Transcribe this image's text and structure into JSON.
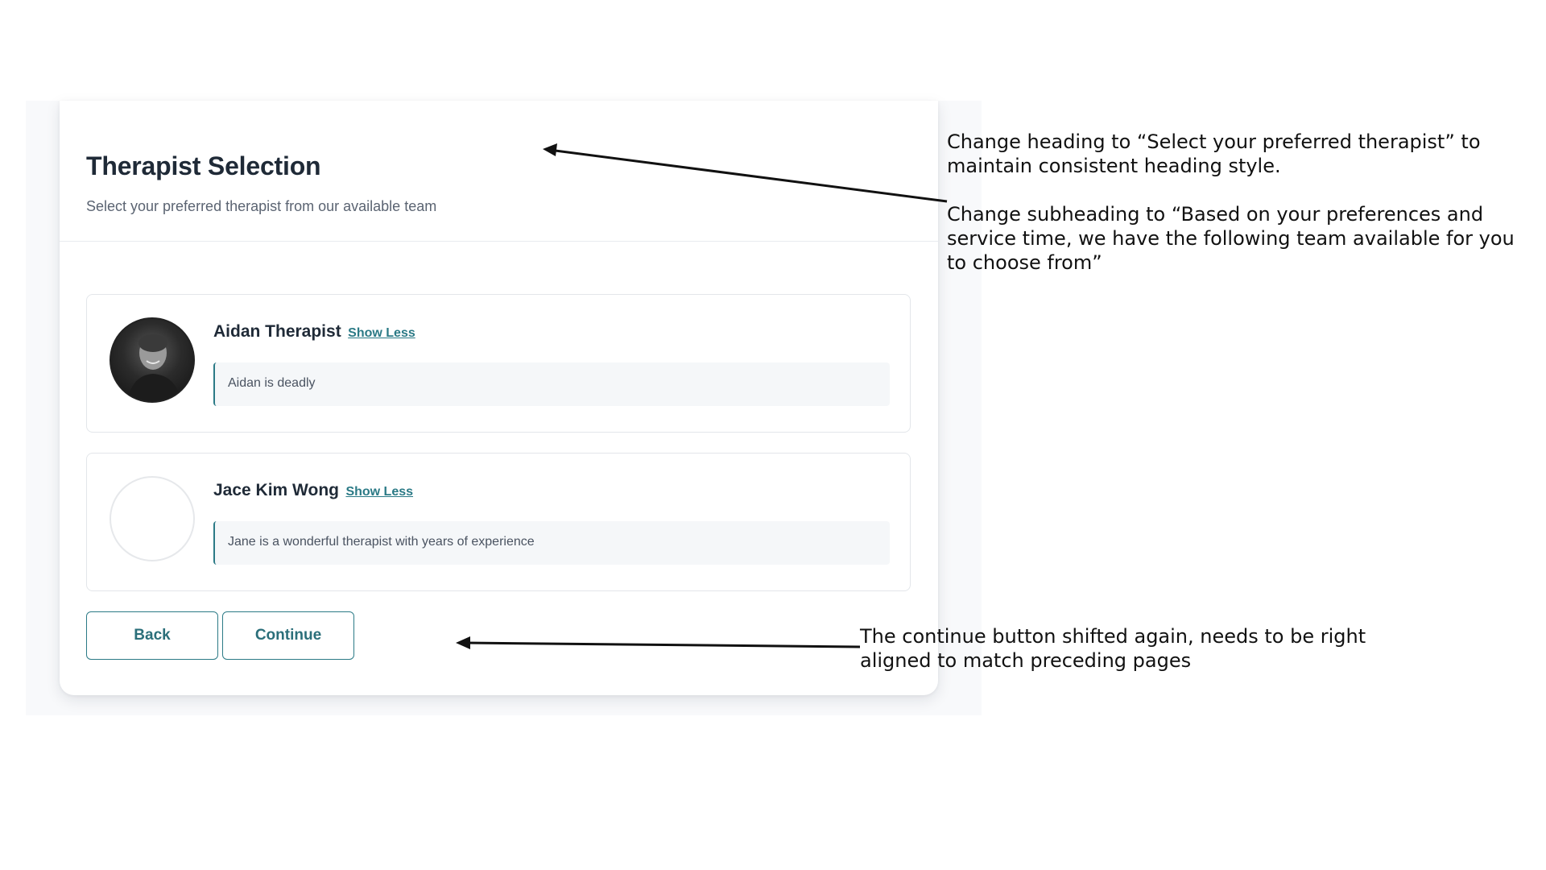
{
  "page": {
    "title": "Therapist Selection",
    "subtitle": "Select your preferred therapist from our available team"
  },
  "therapists": [
    {
      "name": "Aidan Therapist",
      "toggle_label": "Show Less",
      "bio": "Aidan is deadly",
      "has_photo": true
    },
    {
      "name": "Jace Kim Wong",
      "toggle_label": "Show Less",
      "bio": "Jane is a wonderful therapist with years of experience",
      "has_photo": false
    }
  ],
  "actions": {
    "back_label": "Back",
    "continue_label": "Continue"
  },
  "annotations": {
    "heading_note_line1": "Change heading to “Select your preferred therapist” to",
    "heading_note_line2": "maintain consistent heading style.",
    "subheading_note_line1": "Change subheading to “Based on your preferences and",
    "subheading_note_line2": "service time, we have the following team available for you",
    "subheading_note_line3": "to choose from”",
    "button_note_line1": "The continue button shifted again, needs to be right",
    "button_note_line2": "aligned to match preceding pages"
  },
  "colors": {
    "accent": "#2b7a86",
    "heading": "#1f2a37",
    "annotation_text": "#111111"
  }
}
